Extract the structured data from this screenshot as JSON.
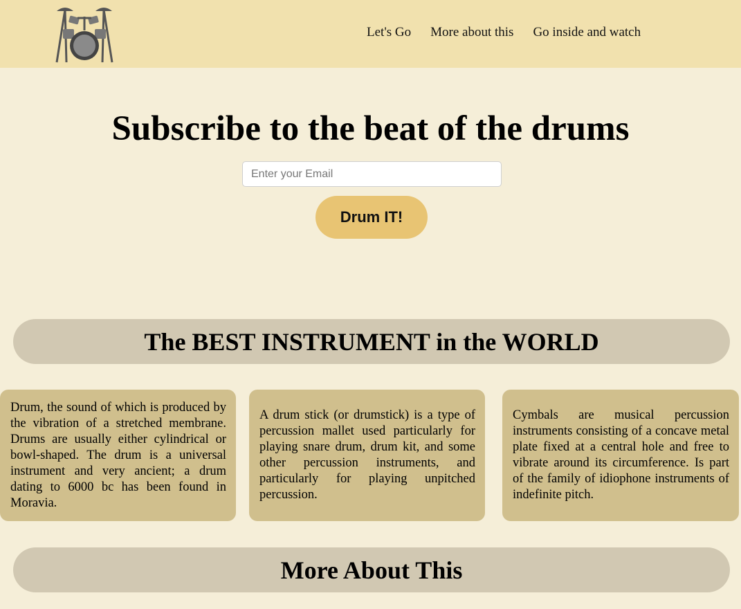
{
  "header": {
    "logo_icon": "drum-kit-icon",
    "nav": [
      "Let's Go",
      "More about this",
      "Go inside and watch"
    ]
  },
  "hero": {
    "title": "Subscribe to the beat of the drums",
    "email_placeholder": "Enter your Email",
    "button_label": "Drum IT!"
  },
  "section1": {
    "title": "The BEST INSTRUMENT in the WORLD",
    "cards": [
      "Drum, the sound of which is produced by the vibration of a stretched membrane. Drums are usually either cylindrical or bowl-shaped. The drum is a universal instrument and very ancient; a drum dating to 6000 bc has been found in Moravia.",
      "A drum stick (or drumstick) is a type of percussion mallet used particularly for playing snare drum, drum kit, and some other percussion instruments, and particularly for playing unpitched percussion.",
      "Cymbals are musical percussion instruments consisting of a concave metal plate fixed at a central hole and free to vibrate around its circumference. Is part of the family of idiophone instruments of indefinite pitch."
    ]
  },
  "section2": {
    "title": "More About This"
  },
  "colors": {
    "header_bg": "#f1e1ae",
    "page_bg": "#f5eed8",
    "button_bg": "#e8c473",
    "banner_bg": "#d1c8b2",
    "card_bg": "#d0bf8d"
  }
}
